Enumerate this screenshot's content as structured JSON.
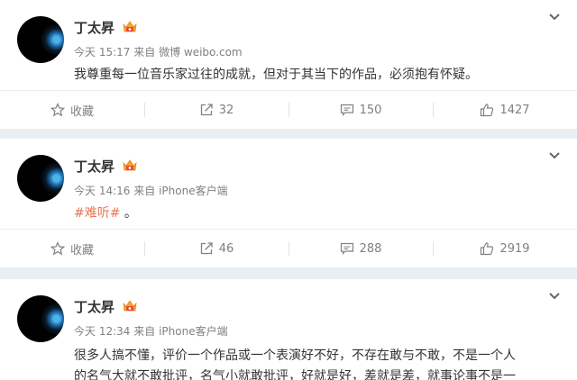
{
  "posts": [
    {
      "author": "丁太昇",
      "time": "今天 15:17",
      "source_prefix": "来自",
      "source": "微博 weibo.com",
      "text": "我尊重每一位音乐家过往的成就，但对于其当下的作品，必须抱有怀疑。",
      "favorite_label": "收藏",
      "reposts": "32",
      "comments": "150",
      "likes": "1427"
    },
    {
      "author": "丁太昇",
      "time": "今天 14:16",
      "source_prefix": "来自",
      "source": "iPhone客户端",
      "topic": "#难听#",
      "text_tail": " 。",
      "favorite_label": "收藏",
      "reposts": "46",
      "comments": "288",
      "likes": "2919"
    },
    {
      "author": "丁太昇",
      "time": "今天 12:34",
      "source_prefix": "来自",
      "source": "iPhone客户端",
      "line1": "很多人搞不懂，评价一个作品或一个表演好不好，不存在敢与不敢，不是一个人",
      "line2": "的名气大就不敢批评，名气小就敢批评，好就是好，差就是差，就事论事不是一"
    }
  ],
  "colors": {
    "topic": "#eb7350",
    "vip_badge": "#f5a623",
    "background": "#e9eef3"
  }
}
